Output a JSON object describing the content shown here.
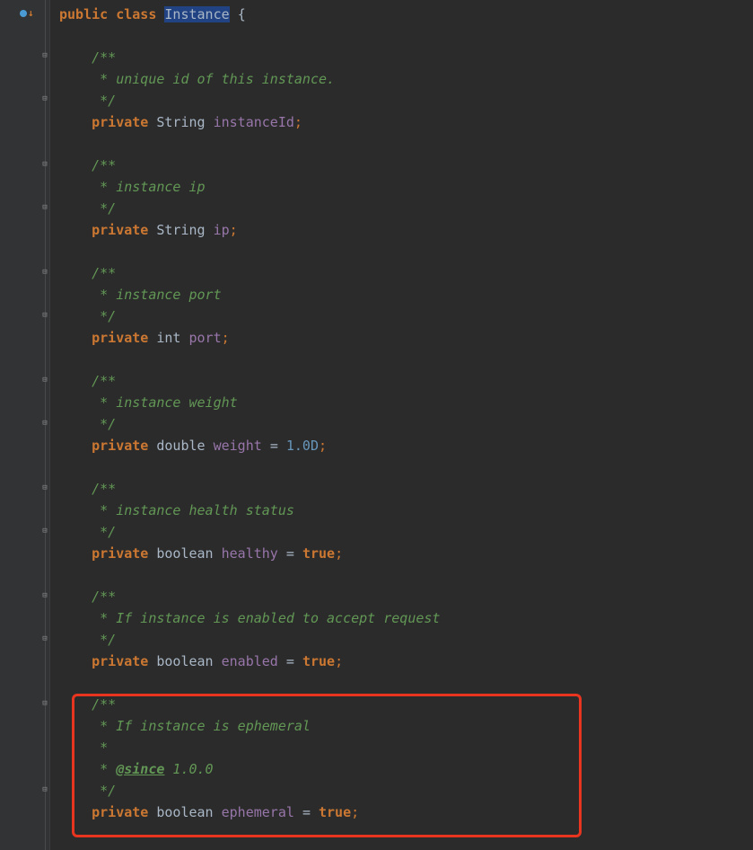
{
  "class_decl": {
    "prefix": "public class ",
    "name": "Instance",
    "suffix": " {"
  },
  "fields": [
    {
      "doc_open": "/**",
      "doc_lines": [
        " * unique id of this instance."
      ],
      "doc_close": " */",
      "modifier": "private",
      "type": "String",
      "name": "instanceId",
      "tail": ";"
    },
    {
      "doc_open": "/**",
      "doc_lines": [
        " * instance ip"
      ],
      "doc_close": " */",
      "modifier": "private",
      "type": "String",
      "name": "ip",
      "tail": ";"
    },
    {
      "doc_open": "/**",
      "doc_lines": [
        " * instance port"
      ],
      "doc_close": " */",
      "modifier": "private",
      "type": "int",
      "name": "port",
      "tail": ";"
    },
    {
      "doc_open": "/**",
      "doc_lines": [
        " * instance weight"
      ],
      "doc_close": " */",
      "modifier": "private",
      "type": "double",
      "name": "weight",
      "tail": " = 1.0D;",
      "value": "1.0D"
    },
    {
      "doc_open": "/**",
      "doc_lines": [
        " * instance health status"
      ],
      "doc_close": " */",
      "modifier": "private",
      "type": "boolean",
      "name": "healthy",
      "tail": " = true;",
      "value_kw": "true"
    },
    {
      "doc_open": "/**",
      "doc_lines": [
        " * If instance is enabled to accept request"
      ],
      "doc_close": " */",
      "modifier": "private",
      "type": "boolean",
      "name": "enabled",
      "tail": " = true;",
      "value_kw": "true"
    },
    {
      "doc_open": "/**",
      "doc_lines": [
        " * If instance is ephemeral",
        " *",
        " * @since 1.0.0"
      ],
      "doc_close": " */",
      "modifier": "private",
      "type": "boolean",
      "name": "ephemeral",
      "tail": " = true;",
      "value_kw": "true",
      "has_since": true,
      "since_tag": "@since",
      "since_ver": " 1.0.0"
    }
  ]
}
